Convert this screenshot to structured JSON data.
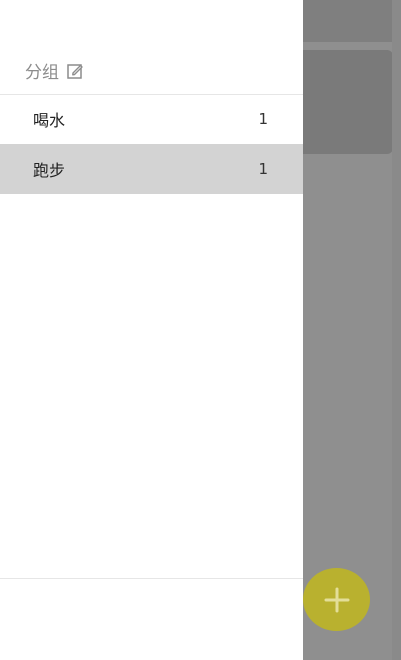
{
  "drawer": {
    "group_title": "分组",
    "groups": [
      {
        "name": "喝水",
        "count": "1",
        "selected": false
      },
      {
        "name": "跑步",
        "count": "1",
        "selected": true
      }
    ]
  },
  "colors": {
    "overlay": "#8f8f8f",
    "selected_row": "#d3d3d3",
    "fab": "#b9b12f",
    "drawer_bg": "#ffffff"
  },
  "icons": {
    "edit": "edit-icon",
    "add_circle": "add-circle-icon",
    "fab_plus": "plus-icon"
  }
}
